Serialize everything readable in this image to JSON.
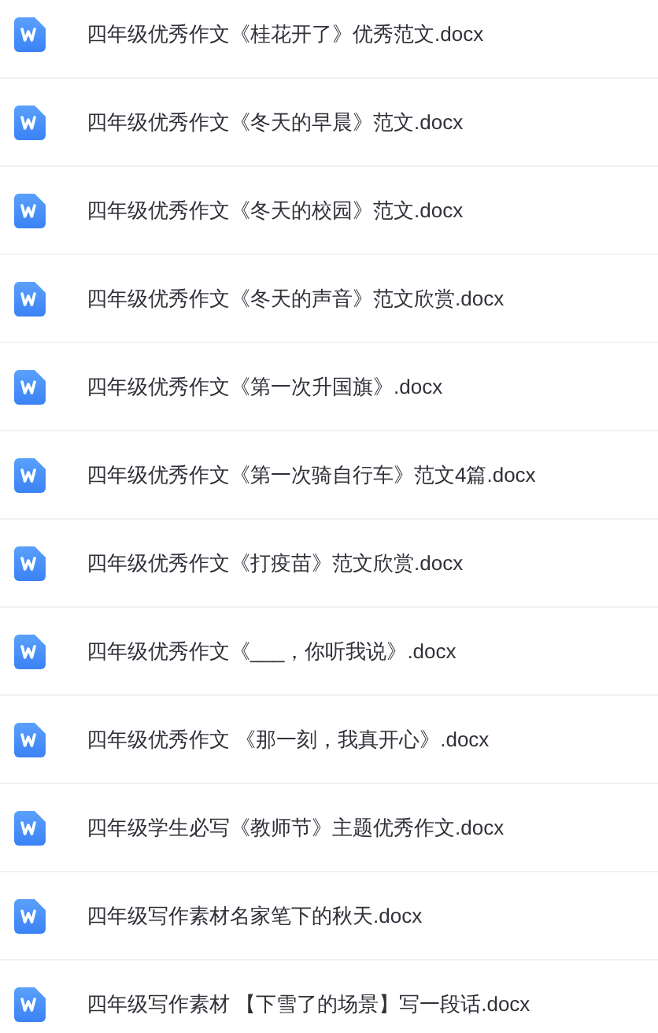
{
  "files": [
    {
      "name": "四年级优秀作文《桂花开了》优秀范文.docx"
    },
    {
      "name": "四年级优秀作文《冬天的早晨》范文.docx"
    },
    {
      "name": "四年级优秀作文《冬天的校园》范文.docx"
    },
    {
      "name": "四年级优秀作文《冬天的声音》范文欣赏.docx"
    },
    {
      "name": "四年级优秀作文《第一次升国旗》.docx"
    },
    {
      "name": "四年级优秀作文《第一次骑自行车》范文4篇.docx"
    },
    {
      "name": "四年级优秀作文《打疫苗》范文欣赏.docx"
    },
    {
      "name": "四年级优秀作文《___，你听我说》.docx"
    },
    {
      "name": "四年级优秀作文 《那一刻，我真开心》.docx"
    },
    {
      "name": "四年级学生必写《教师节》主题优秀作文.docx"
    },
    {
      "name": "四年级写作素材名家笔下的秋天.docx"
    },
    {
      "name": "四年级写作素材 【下雪了的场景】写一段话.docx"
    }
  ]
}
